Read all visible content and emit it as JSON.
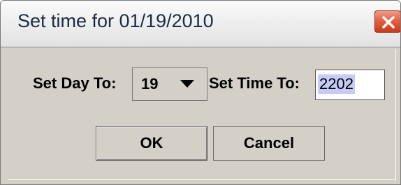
{
  "window": {
    "title": "Set time for 01/19/2010",
    "close_icon": "close-icon"
  },
  "form": {
    "day_label": "Set Day To:",
    "day_value": "19",
    "dropdown_icon": "chevron-down-icon",
    "time_label": "Set Time To:",
    "time_value": "2202"
  },
  "buttons": {
    "ok_label": "OK",
    "cancel_label": "Cancel"
  },
  "colors": {
    "close_button": "#e25c3d",
    "selection_highlight": "#c7cbf7",
    "dialog_background": "#d4d0c8"
  }
}
